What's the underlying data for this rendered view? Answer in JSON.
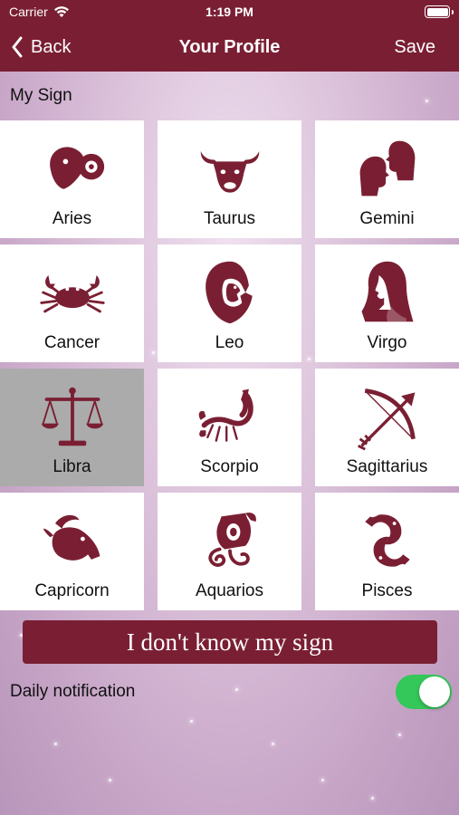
{
  "status_bar": {
    "carrier": "Carrier",
    "time": "1:19 PM",
    "wifi_icon": "wifi-icon",
    "battery_icon": "battery-icon"
  },
  "nav": {
    "back_label": "Back",
    "title": "Your Profile",
    "save_label": "Save"
  },
  "section": {
    "label": "My Sign"
  },
  "signs": [
    {
      "label": "Aries",
      "icon": "ram-icon",
      "selected": false
    },
    {
      "label": "Taurus",
      "icon": "bull-icon",
      "selected": false
    },
    {
      "label": "Gemini",
      "icon": "twins-icon",
      "selected": false
    },
    {
      "label": "Cancer",
      "icon": "crab-icon",
      "selected": false
    },
    {
      "label": "Leo",
      "icon": "lion-icon",
      "selected": false
    },
    {
      "label": "Virgo",
      "icon": "maiden-icon",
      "selected": false
    },
    {
      "label": "Libra",
      "icon": "scales-icon",
      "selected": true
    },
    {
      "label": "Scorpio",
      "icon": "scorpion-icon",
      "selected": false
    },
    {
      "label": "Sagittarius",
      "icon": "bow-arrow-icon",
      "selected": false
    },
    {
      "label": "Capricorn",
      "icon": "goat-icon",
      "selected": false
    },
    {
      "label": "Aquarios",
      "icon": "water-bearer-icon",
      "selected": false
    },
    {
      "label": "Pisces",
      "icon": "fish-icon",
      "selected": false
    }
  ],
  "unknown_button": {
    "label": "I don't know my sign"
  },
  "notification": {
    "label": "Daily notification",
    "enabled": true
  },
  "colors": {
    "brand": "#7a1f33",
    "toggle_on": "#34c759",
    "selected_tile": "#ababab"
  }
}
